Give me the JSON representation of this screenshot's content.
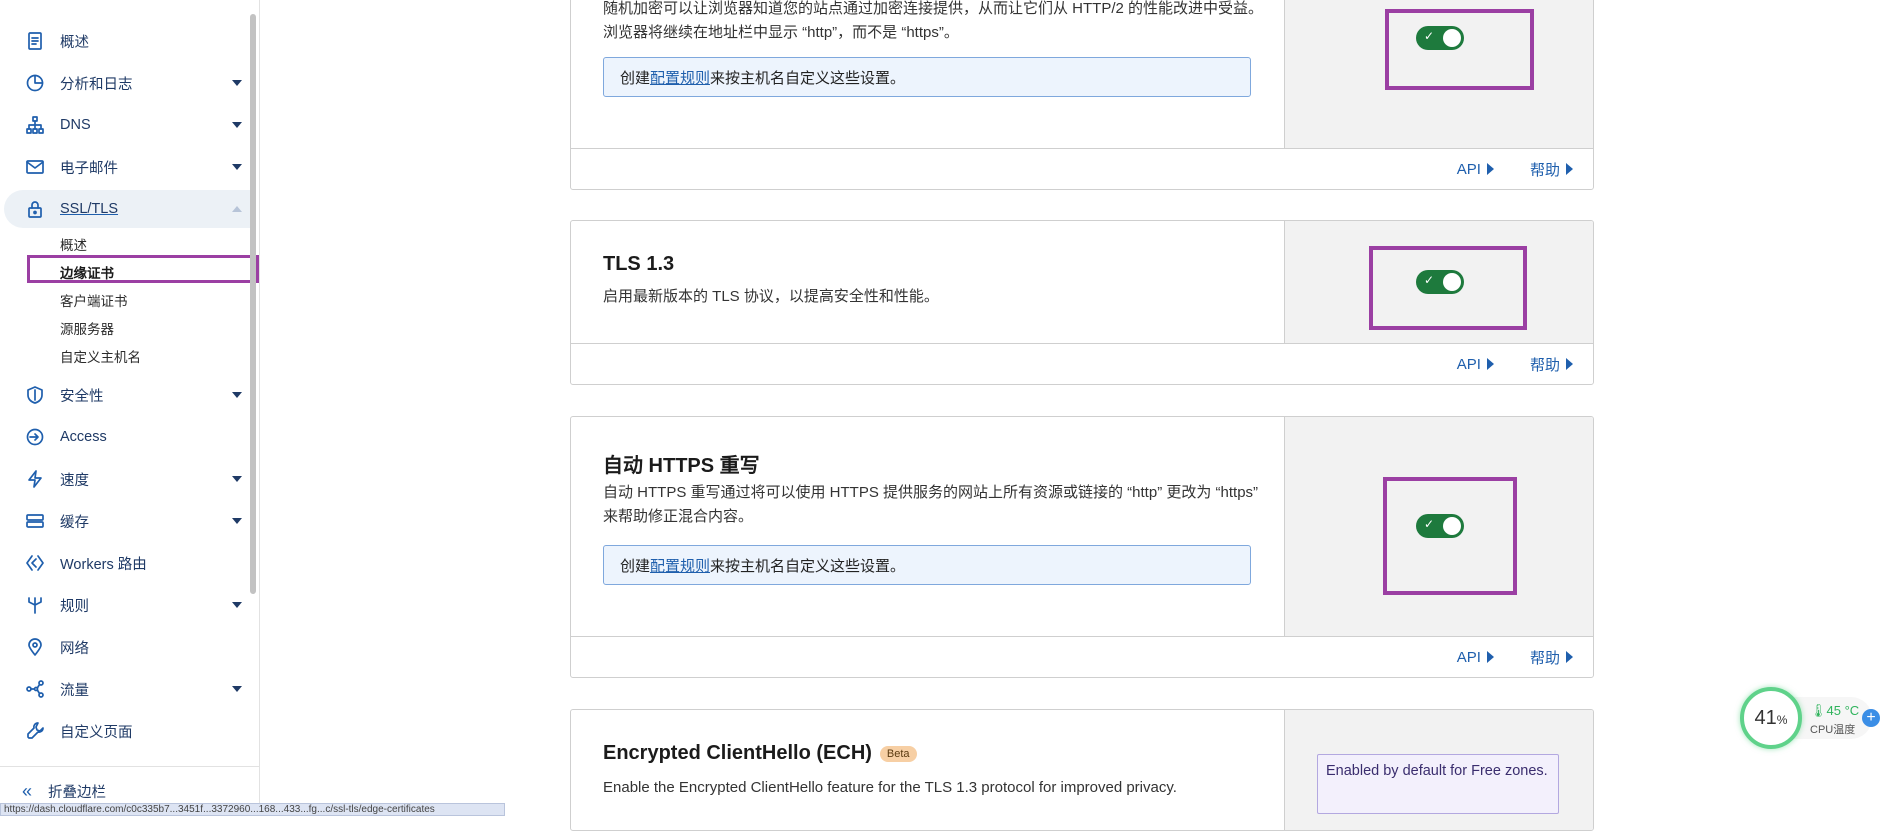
{
  "sidebar": {
    "items": [
      {
        "label": "概述",
        "icon": "document-icon",
        "has_caret": false
      },
      {
        "label": "分析和日志",
        "icon": "chart-pie-icon",
        "has_caret": true
      },
      {
        "label": "DNS",
        "icon": "network-icon",
        "has_caret": true
      },
      {
        "label": "电子邮件",
        "icon": "mail-icon",
        "has_caret": true
      },
      {
        "label": "SSL/TLS",
        "icon": "lock-icon",
        "has_caret": true,
        "expanded": true
      },
      {
        "label": "安全性",
        "icon": "shield-icon",
        "has_caret": true
      },
      {
        "label": "Access",
        "icon": "access-icon",
        "has_caret": false
      },
      {
        "label": "速度",
        "icon": "lightning-icon",
        "has_caret": true
      },
      {
        "label": "缓存",
        "icon": "cache-icon",
        "has_caret": true
      },
      {
        "label": "Workers 路由",
        "icon": "workers-icon",
        "has_caret": false
      },
      {
        "label": "规则",
        "icon": "rules-icon",
        "has_caret": true
      },
      {
        "label": "网络",
        "icon": "location-icon",
        "has_caret": false
      },
      {
        "label": "流量",
        "icon": "traffic-icon",
        "has_caret": true
      },
      {
        "label": "自定义页面",
        "icon": "wrench-icon",
        "has_caret": false
      }
    ],
    "ssl_subitems": [
      "概述",
      "边缘证书",
      "客户端证书",
      "源服务器",
      "自定义主机名"
    ],
    "current_subitem": "边缘证书",
    "collapse_label": "折叠边栏",
    "status_url": "https://dash.cloudflare.com/c0c335b7...3451f...3372960...168...433...fg...c/ssl-tls/edge-certificates"
  },
  "cards": {
    "http2": {
      "desc": "随机加密可以让浏览器知道您的站点通过加密连接提供，从而让它们从 HTTP/2 的性能改进中受益。浏览器将继续在地址栏中显示 “http”，而不是 “https”。",
      "rule_prefix": "创建",
      "rule_link": "配置规则",
      "rule_suffix": "来按主机名自定义这些设置。",
      "toggle_on": true
    },
    "tls13": {
      "title": "TLS 1.3",
      "desc": "启用最新版本的 TLS 协议，以提高安全性和性能。",
      "toggle_on": true
    },
    "https_rewrite": {
      "title": "自动 HTTPS 重写",
      "desc": "自动 HTTPS 重写通过将可以使用 HTTPS 提供服务的网站上所有资源或链接的 “http” 更改为 “https” 来帮助修正混合内容。",
      "rule_prefix": "创建",
      "rule_link": "配置规则",
      "rule_suffix": "来按主机名自定义这些设置。",
      "toggle_on": true
    },
    "ech": {
      "title": "Encrypted ClientHello (ECH)",
      "badge": "Beta",
      "desc": "Enable the Encrypted ClientHello feature for the TLS 1.3 protocol for improved privacy.",
      "note": "Enabled by default for Free zones."
    },
    "footer": {
      "api_label": "API",
      "help_label": "帮助"
    }
  },
  "cpu_widget": {
    "percent": "41",
    "percent_unit": "%",
    "temperature": "45 °C",
    "label": "CPU温度",
    "plus": "+"
  }
}
